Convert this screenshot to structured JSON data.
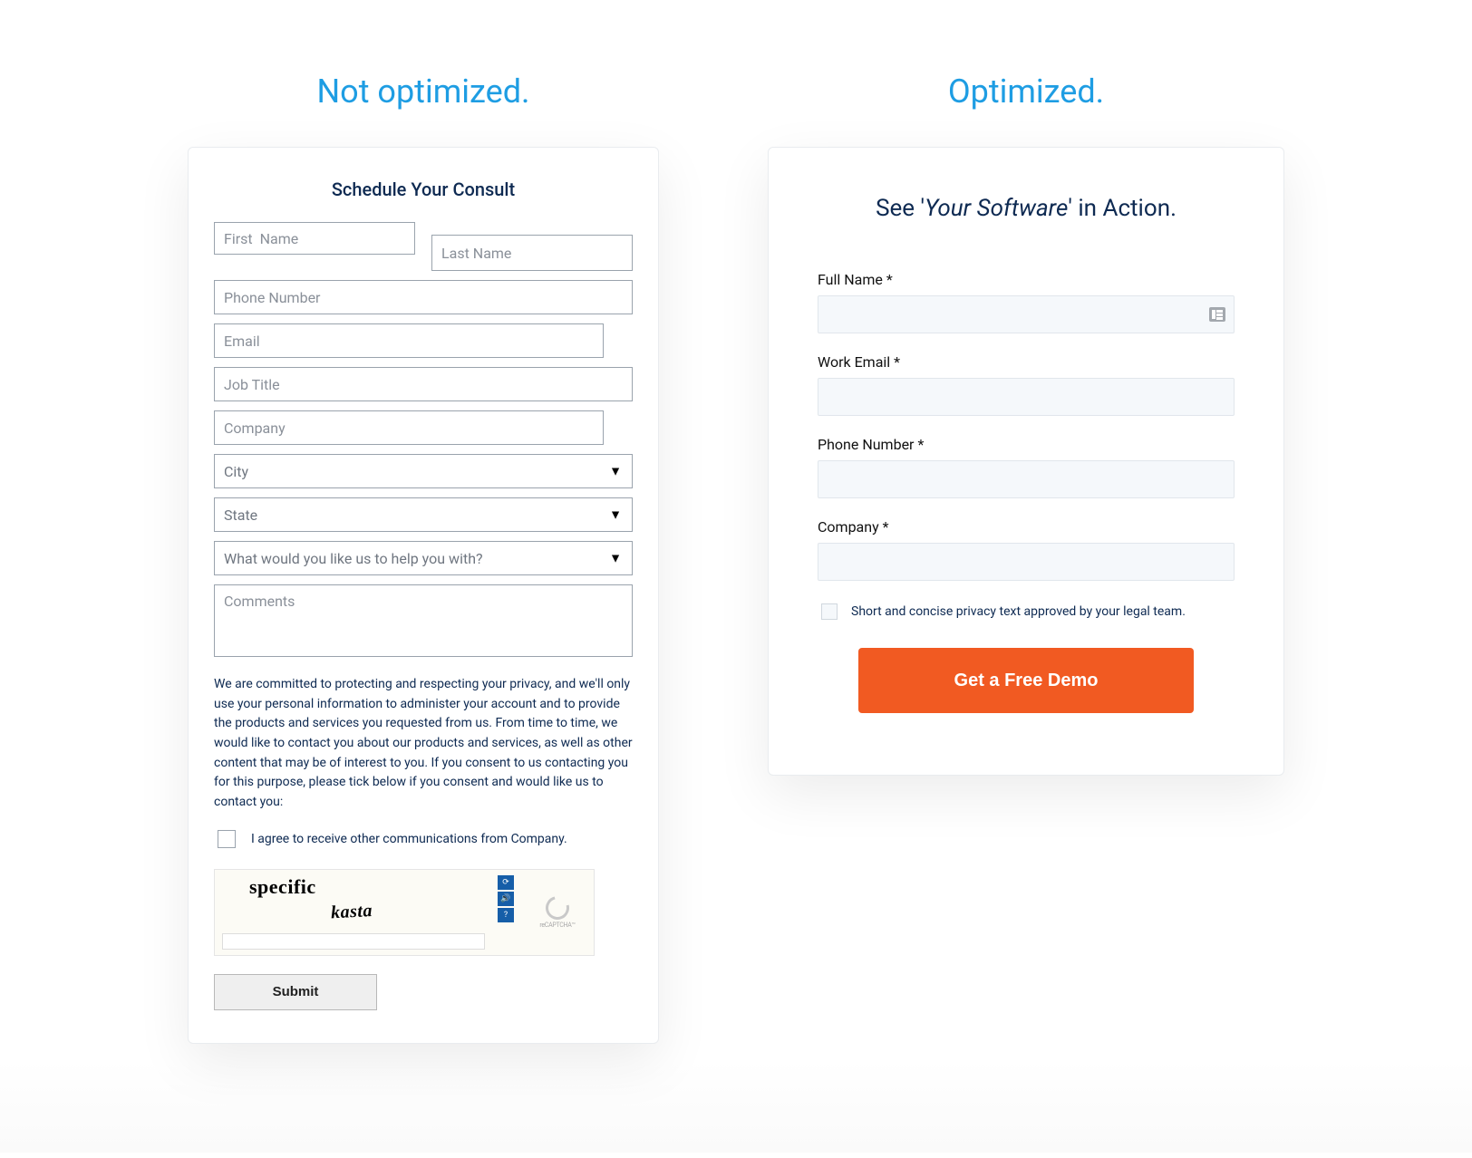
{
  "left": {
    "heading": "Not optimized.",
    "title": "Schedule Your Consult",
    "fields": {
      "first_name": "First  Name",
      "last_name": "Last Name",
      "phone": "Phone Number",
      "email": "Email",
      "job_title": "Job Title",
      "company": "Company",
      "city": "City",
      "state": "State",
      "help": "What would you like us to help you with?",
      "comments": "Comments"
    },
    "privacy_text": "We are committed to protecting and respecting your privacy, and we'll only use your personal information to administer your account and to provide the products and services you requested from us. From time to time, we would like to contact you about our products and services, as well as other content that may be of interest to you. If you consent to us contacting you for this purpose, please tick below if you consent and would like us to contact you:",
    "agree_label": "I agree to receive other communications from Company.",
    "captcha_word1": "specific",
    "captcha_word2": "kasta",
    "recaptcha_label": "reCAPTCHA™",
    "submit_label": "Submit"
  },
  "right": {
    "heading": "Optimized.",
    "title_pre": "See '",
    "title_italic": "Your Software",
    "title_post": "' in Action.",
    "fields": {
      "full_name": "Full Name *",
      "work_email": "Work Email *",
      "phone": "Phone Number *",
      "company": "Company *"
    },
    "privacy_short": "Short and concise privacy text approved by your legal team.",
    "cta_label": "Get a Free Demo"
  },
  "colors": {
    "heading_blue": "#1e9de3",
    "cta_orange": "#f15a22",
    "text_navy": "#0e2a52"
  }
}
